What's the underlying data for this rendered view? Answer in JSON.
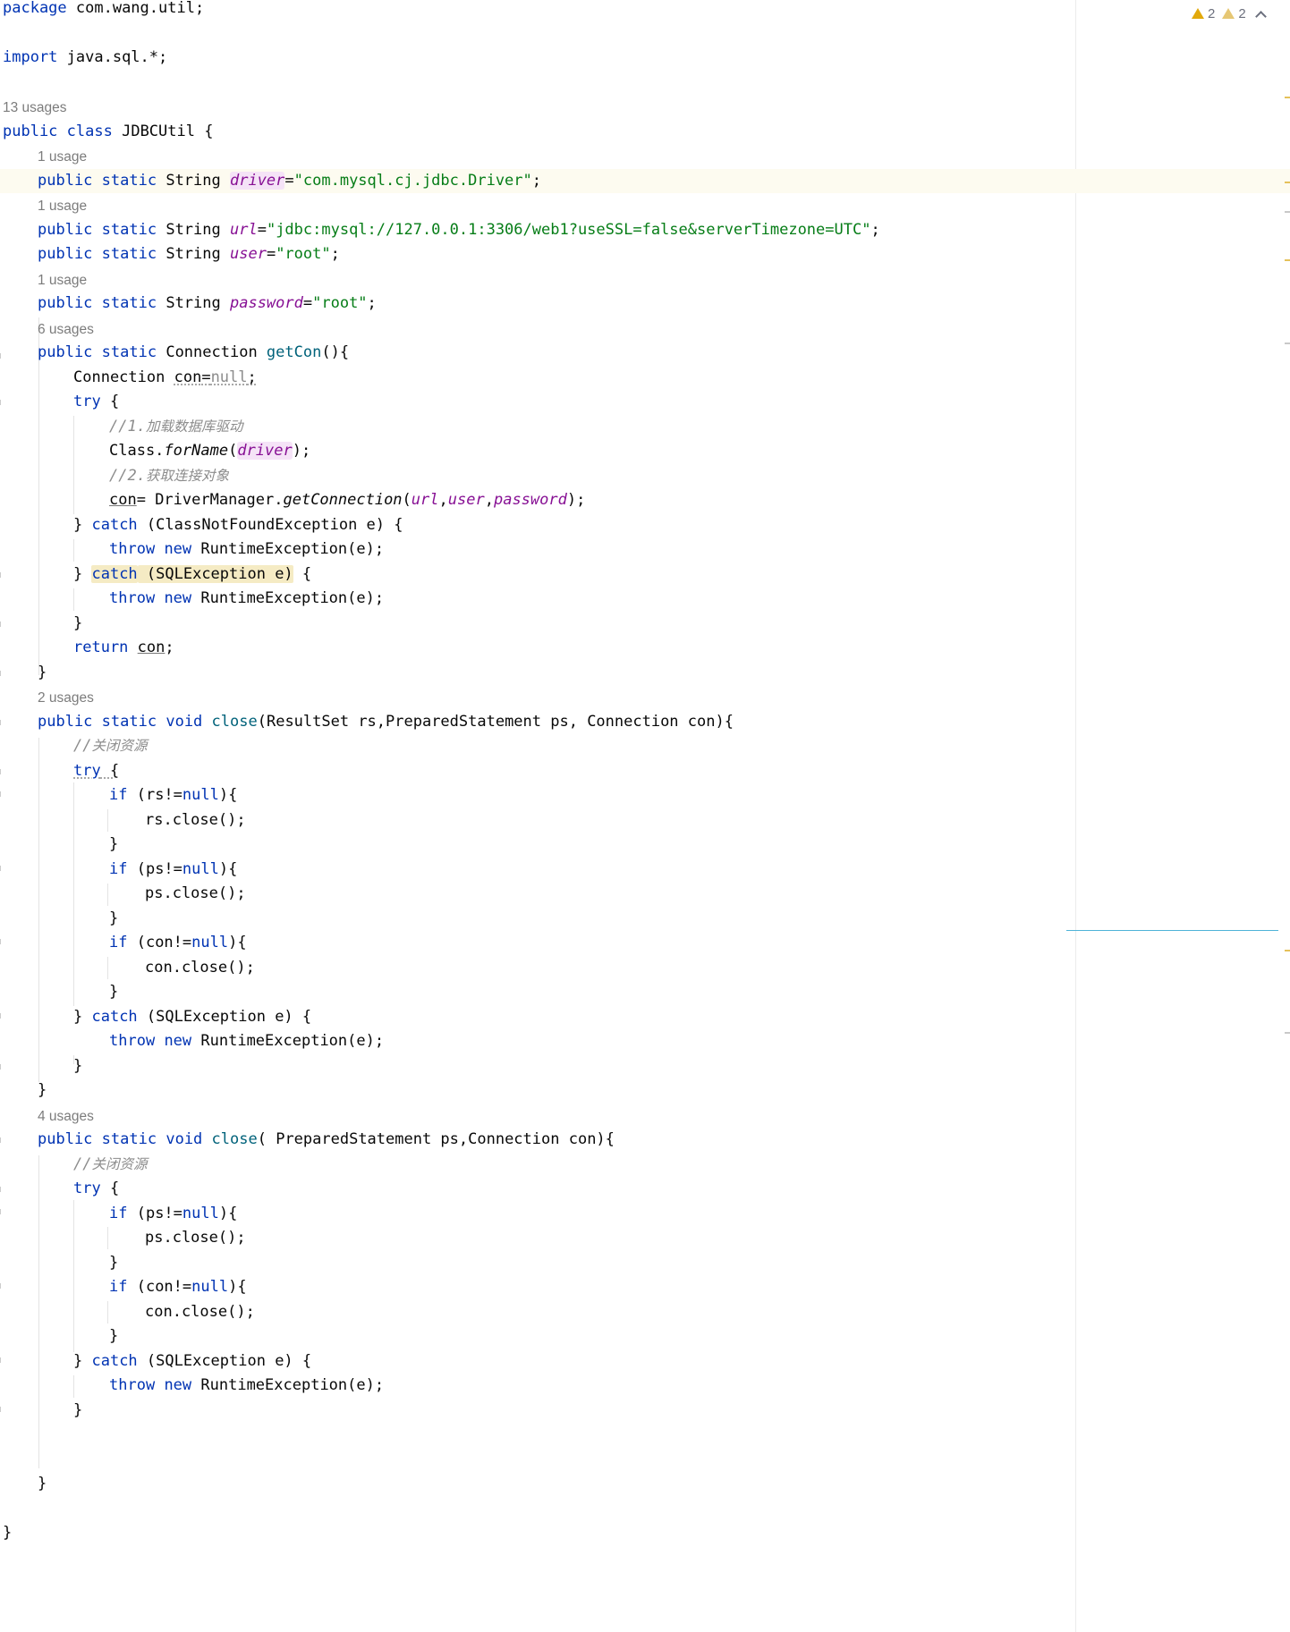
{
  "inspection": {
    "warnings": "2",
    "weak_warnings": "2"
  },
  "hints": {
    "h13": "13 usages",
    "h1a": "1 usage",
    "h1b": "1 usage",
    "h1c": "1 usage",
    "h6": "6 usages",
    "h2": "2 usages",
    "h4": "4 usages"
  },
  "code": {
    "l1": [
      "package",
      " com.wang.util;"
    ],
    "l2": [
      "import",
      " java.sql.*;"
    ],
    "l3": [
      "public",
      " ",
      "class",
      " JDBCUtil {"
    ],
    "l4": [
      "public",
      " ",
      "static",
      " String ",
      "driver",
      "=",
      "\"com.mysql.cj.jdbc.Driver\"",
      ";"
    ],
    "l5": [
      "public",
      " ",
      "static",
      " String ",
      "url",
      "=",
      "\"jdbc:mysql://127.0.0.1:3306/web1?useSSL=false&serverTimezone=UTC\"",
      ";"
    ],
    "l6": [
      "public",
      " ",
      "static",
      " String ",
      "user",
      "=",
      "\"root\"",
      ";"
    ],
    "l7": [
      "public",
      " ",
      "static",
      " String ",
      "password",
      "=",
      "\"root\"",
      ";"
    ],
    "l8": [
      "public",
      " ",
      "static",
      " Connection ",
      "getCon",
      "(){"
    ],
    "l9": [
      "Connection ",
      "con",
      "=",
      "null",
      ";"
    ],
    "l10": [
      "try",
      " {"
    ],
    "l11": [
      "//1.",
      "加载数据库驱动"
    ],
    "l12": [
      "Class.",
      "forName",
      "(",
      "driver",
      ");"
    ],
    "l13": [
      "//2.",
      "获取连接对象"
    ],
    "l14": [
      "con",
      "= DriverManager.",
      "getConnection",
      "(",
      "url",
      ",",
      "user",
      ",",
      "password",
      ");"
    ],
    "l15": [
      "} ",
      "catch",
      " (ClassNotFoundException e) {"
    ],
    "l16": [
      "throw",
      " ",
      "new",
      " RuntimeException(e);"
    ],
    "l17": [
      "} ",
      "catch",
      " (SQLException e)",
      " {"
    ],
    "l18": [
      "throw",
      " ",
      "new",
      " RuntimeException(e);"
    ],
    "l19": [
      "}"
    ],
    "l20": [
      "return",
      " ",
      "con",
      ";"
    ],
    "l21": [
      "}"
    ],
    "l22": [
      "public",
      " ",
      "static",
      " ",
      "void",
      " ",
      "close",
      "(ResultSet rs,PreparedStatement ps, Connection con){"
    ],
    "l23": [
      "//",
      "关闭资源"
    ],
    "l24": [
      "try",
      " {"
    ],
    "l25": [
      "if",
      " (rs!=",
      "null",
      "){"
    ],
    "l26": [
      "rs.close();"
    ],
    "l27": [
      "}"
    ],
    "l28": [
      "if",
      " (ps!=",
      "null",
      "){"
    ],
    "l29": [
      "ps.close();"
    ],
    "l30": [
      "}"
    ],
    "l31": [
      "if",
      " (con!=",
      "null",
      "){"
    ],
    "l32": [
      "con.close();"
    ],
    "l33": [
      "}"
    ],
    "l34": [
      "} ",
      "catch",
      " (SQLException e) {"
    ],
    "l35": [
      "throw",
      " ",
      "new",
      " RuntimeException(e);"
    ],
    "l36": [
      "}"
    ],
    "l37": [
      "}"
    ],
    "l38": [
      "public",
      " ",
      "static",
      " ",
      "void",
      " ",
      "close",
      "( PreparedStatement ps,Connection con){"
    ],
    "l39": [
      "//",
      "关闭资源"
    ],
    "l40": [
      "try",
      " {"
    ],
    "l41": [
      "if",
      " (ps!=",
      "null",
      "){"
    ],
    "l42": [
      "ps.close();"
    ],
    "l43": [
      "}"
    ],
    "l44": [
      "if",
      " (con!=",
      "null",
      "){"
    ],
    "l45": [
      "con.close();"
    ],
    "l46": [
      "}"
    ],
    "l47": [
      "} ",
      "catch",
      " (SQLException e) {"
    ],
    "l48": [
      "throw",
      " ",
      "new",
      " RuntimeException(e);"
    ],
    "l49": [
      "}"
    ],
    "l50": [
      "}"
    ],
    "l51": [
      "}"
    ]
  }
}
